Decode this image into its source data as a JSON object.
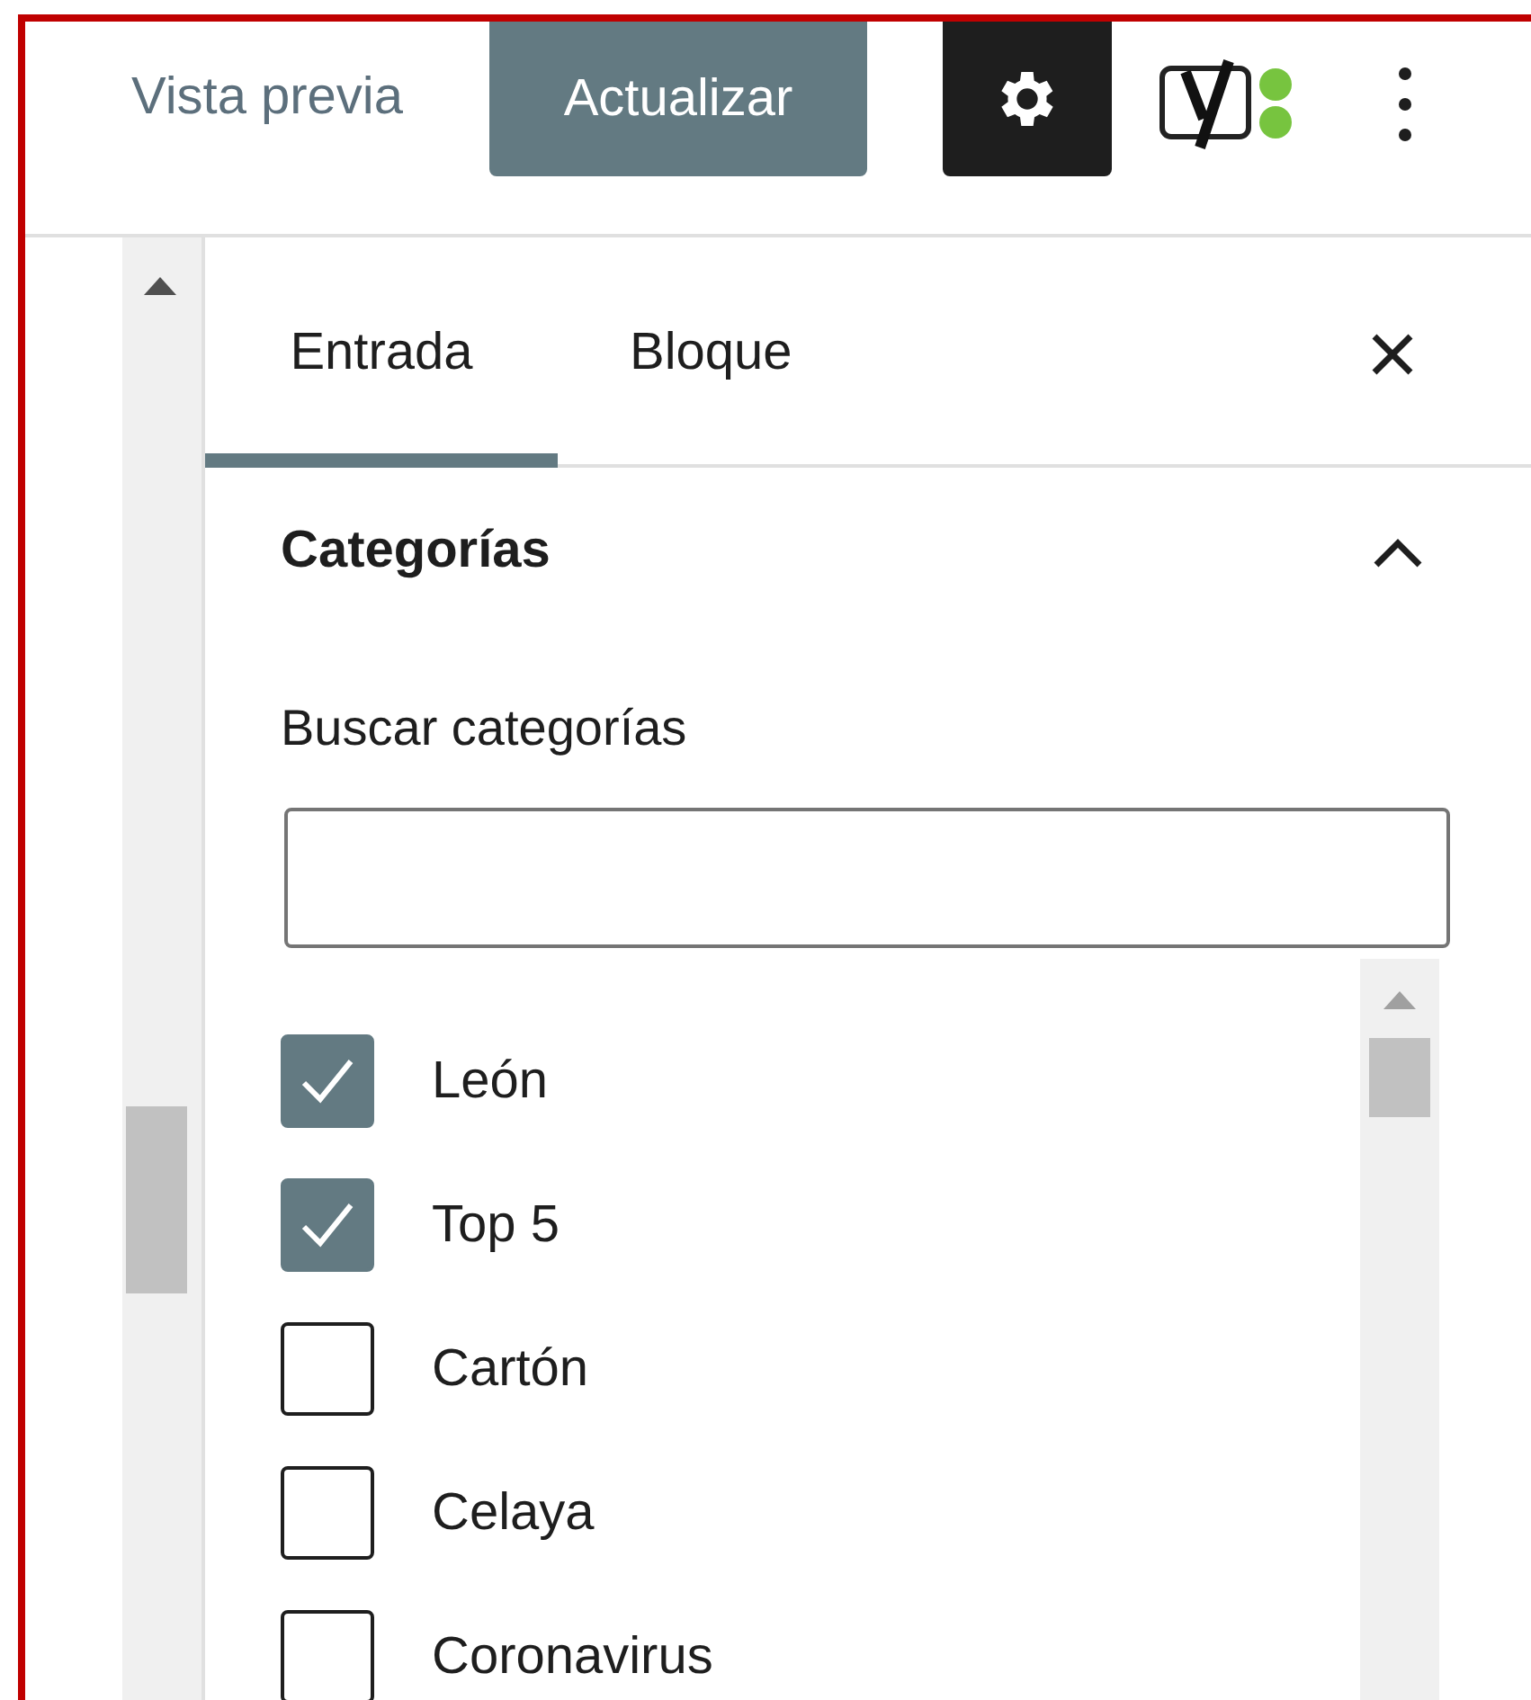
{
  "header": {
    "preview_link": "Vista previa",
    "update_button": "Actualizar",
    "settings_pressed": true
  },
  "tabs": [
    {
      "label": "Entrada",
      "selected": true
    },
    {
      "label": "Bloque",
      "selected": false
    }
  ],
  "panel": {
    "title": "Categorías",
    "expanded": true,
    "search_label": "Buscar categorías",
    "categories": [
      {
        "label": "León",
        "checked": true
      },
      {
        "label": "Top 5",
        "checked": true
      },
      {
        "label": "Cartón",
        "checked": false
      },
      {
        "label": "Celaya",
        "checked": false
      },
      {
        "label": "Coronavirus",
        "checked": false
      }
    ]
  }
}
